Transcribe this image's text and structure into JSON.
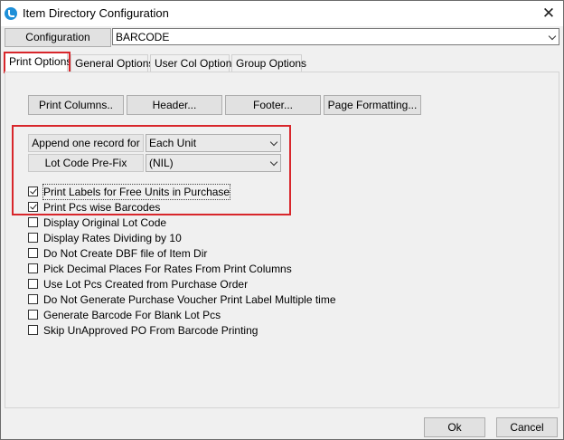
{
  "window": {
    "title": "Item Directory Configuration",
    "close_glyph": "✕"
  },
  "config": {
    "label": "Configuration",
    "selected": "BARCODE"
  },
  "tabs": [
    {
      "label": "Print Options",
      "active": true
    },
    {
      "label": "General Options",
      "active": false
    },
    {
      "label": "User Col Options",
      "active": false
    },
    {
      "label": "Group Options",
      "active": false
    }
  ],
  "buttons": {
    "print_columns": "Print Columns..",
    "header": "Header...",
    "footer": "Footer...",
    "page_formatting": "Page Formatting..."
  },
  "fields": {
    "append_label": "Append one record for",
    "append_value": "Each Unit",
    "lot_prefix_label": "Lot Code Pre-Fix",
    "lot_prefix_value": "(NIL)"
  },
  "checkboxes": [
    {
      "label": "Print Labels for Free Units in Purchase",
      "checked": true
    },
    {
      "label": "Print Pcs wise Barcodes",
      "checked": true
    },
    {
      "label": "Display Original Lot Code",
      "checked": false
    },
    {
      "label": "Display Rates Dividing by 10",
      "checked": false
    },
    {
      "label": "Do Not Create DBF file of Item Dir",
      "checked": false
    },
    {
      "label": "Pick Decimal Places For Rates From Print Columns",
      "checked": false
    },
    {
      "label": "Use Lot Pcs Created from Purchase Order",
      "checked": false
    },
    {
      "label": "Do Not Generate Purchase Voucher Print Label Multiple time",
      "checked": false
    },
    {
      "label": "Generate Barcode For Blank Lot Pcs",
      "checked": false
    },
    {
      "label": "Skip UnApproved PO From Barcode Printing",
      "checked": false
    }
  ],
  "footer": {
    "ok": "Ok",
    "cancel": "Cancel"
  },
  "colors": {
    "highlight": "#d8262b",
    "app_icon": "#1e8fd8"
  }
}
